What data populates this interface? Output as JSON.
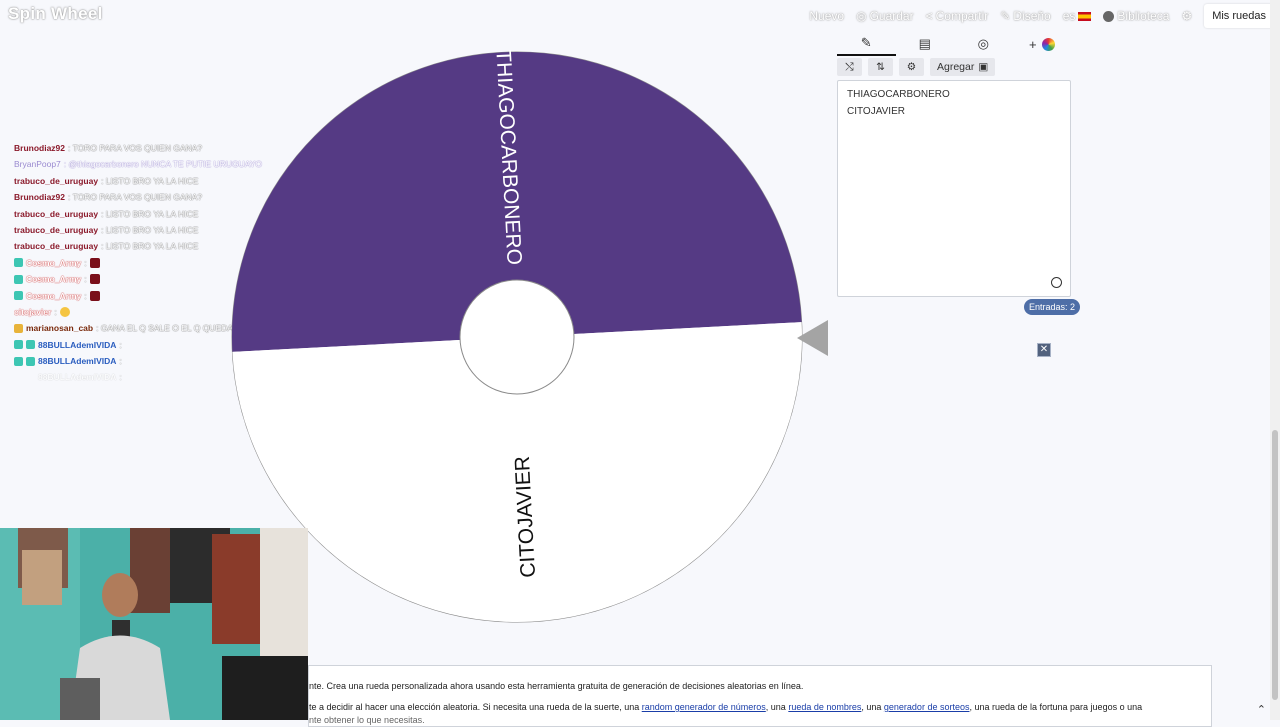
{
  "app": {
    "logo": "Spin Wheel",
    "nav": {
      "nuevo": "Nuevo",
      "guardar": "Guardar",
      "compartir": "Compartir",
      "diseno": "Diseño",
      "lang": "es",
      "biblioteca": "Biblioteca",
      "mis_ruedas": "Mis ruedas"
    }
  },
  "chat": [
    {
      "user": "Brunodiaz92",
      "msg": ": TORO PARA VOS QUIEN GANA?"
    },
    {
      "user": "BryanPoop7",
      "msg": ": @thiagocarbonero NUNCA TE PUTIE URUGUAYO"
    },
    {
      "user": "trabuco_de_uruguay",
      "msg": ": LISTO BRO YA LA HICE"
    },
    {
      "user": "Brunodiaz92",
      "msg": ": TORO PARA VOS QUIEN GANA?"
    },
    {
      "user": "trabuco_de_uruguay",
      "msg": ": LISTO BRO YA LA HICE"
    },
    {
      "user": "trabuco_de_uruguay",
      "msg": ": LISTO BRO YA LA HICE"
    },
    {
      "user": "trabuco_de_uruguay",
      "msg": ": LISTO BRO YA LA HICE"
    },
    {
      "user": "Cosmo_Army",
      "msg": ":"
    },
    {
      "user": "Cosmo_Army",
      "msg": ":"
    },
    {
      "user": "Cosmo_Army",
      "msg": ":"
    },
    {
      "user": "citojavier",
      "msg": ":"
    },
    {
      "user": "marianosan_cab",
      "msg": ": GANA EL Q SALE O EL Q QUEDA?"
    },
    {
      "user": "88BULLAdemIVIDA",
      "msg": ":"
    },
    {
      "user": "88BULLAdemIVIDA",
      "msg": ":"
    },
    {
      "user": "88BULLAdemIVIDA",
      "msg": ":"
    }
  ],
  "wheel": {
    "segments": [
      {
        "label": "THIAGOCARBONERO",
        "color": "#553a84",
        "text_color": "#ffffff"
      },
      {
        "label": "CITOJAVIER",
        "color": "#ffffff",
        "text_color": "#111111"
      }
    ],
    "pointer_color": "#a4a4a4"
  },
  "editor": {
    "tabs": [
      "pencil-icon",
      "clipboard-icon",
      "eye-slash-icon",
      "palette-icon"
    ],
    "toolbar": {
      "agregar": "Agregar"
    },
    "entries": [
      "THIAGOCARBONERO",
      "CITOJAVIER"
    ],
    "entries_count": "Entradas: 2"
  },
  "bottom": {
    "line1": "nte. Crea una rueda personalizada ahora usando esta herramienta gratuita de generación de decisiones aleatorias en línea.",
    "line2_a": "te a decidir al hacer una elección aleatoria. Si necesita una rueda de la suerte, una ",
    "link1": "random generador de números",
    "line2_b": ", una ",
    "link2": "rueda de nombres",
    "line2_c": ", una ",
    "link3": "generador de sorteos",
    "line2_d": ", una rueda de la fortuna para juegos o una",
    "line3": "nte obtener lo que necesitas."
  }
}
